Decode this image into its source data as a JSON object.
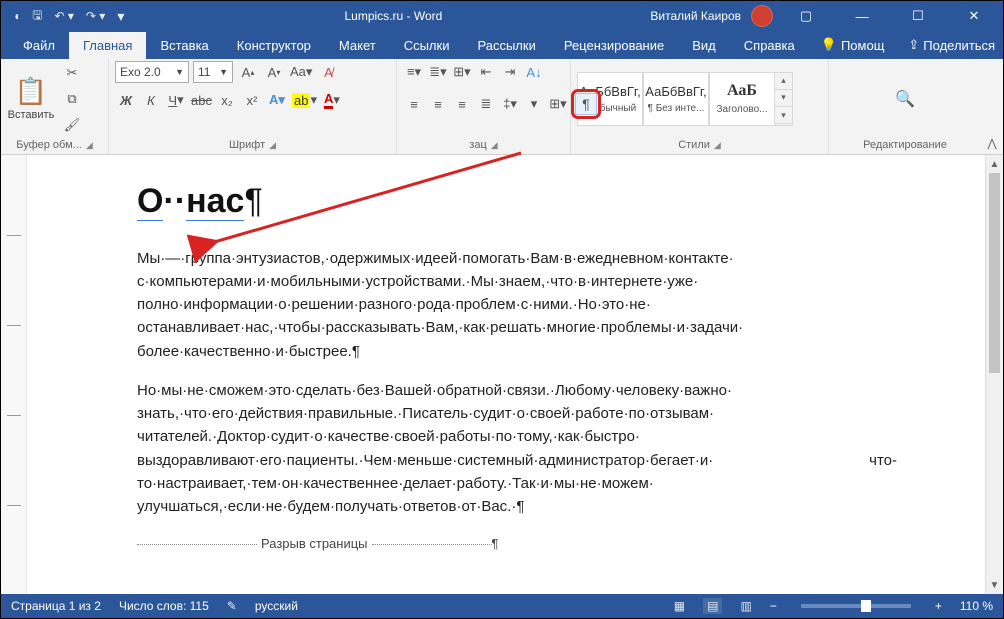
{
  "titlebar": {
    "title": "Lumpics.ru  -  Word",
    "user": "Виталий Каиров"
  },
  "menubar": {
    "file": "Файл",
    "home": "Главная",
    "insert": "Вставка",
    "design": "Конструктор",
    "layout": "Макет",
    "references": "Ссылки",
    "mailings": "Рассылки",
    "review": "Рецензирование",
    "view": "Вид",
    "help": "Справка",
    "tellme": "Помощ",
    "share": "Поделиться"
  },
  "ribbon": {
    "clipboard": {
      "paste": "Вставить",
      "label": "Буфер обм..."
    },
    "font": {
      "name": "Exo 2.0",
      "size": "11",
      "bold": "Ж",
      "italic": "К",
      "underline": "Ч",
      "strike": "abc",
      "sub": "x₂",
      "sup": "x²",
      "label": "Шрифт"
    },
    "paragraph": {
      "pilcrow": "¶",
      "label": "зац"
    },
    "styles": {
      "items": [
        {
          "preview": "АаБбВвГг,",
          "name": "¶ Обычный"
        },
        {
          "preview": "АаБбВвГг,",
          "name": "¶ Без инте..."
        },
        {
          "preview": "АаБ",
          "name": "Заголово..."
        }
      ],
      "label": "Стили"
    },
    "editing": {
      "label": "Редактирование"
    }
  },
  "document": {
    "heading_pre": "О",
    "heading_post": "нас",
    "pil": "¶",
    "p1": "Мы·—·группа·энтузиастов,·одержимых·идеей·помогать·Вам·в·ежедневном·контакте· с·компьютерами·и·мобильными·устройствами.·Мы·знаем,·что·в·интернете·уже· полно·информации·о·решении·разного·рода·проблем·с·ними.·Но·это·не· останавливает·нас,·чтобы·рассказывать·Вам,·как·решать·многие·проблемы·и·задачи· более·качественно·и·быстрее.¶",
    "p2": "Но·мы·не·сможем·это·сделать·без·Вашей·обратной·связи.·Любому·человеку·важно· знать,·что·его·действия·правильные.·Писатель·судит·о·своей·работе·по·отзывам· читателей.·Доктор·судит·о·качестве·своей·работы·по·тому,·как·быстро· выздоравливают·его·пациенты.·Чем·меньше·системный·администратор·бегает·и· что-то·настраивает,·тем·он·качественнее·делает·работу.·Так·и·мы·не·можем· улучшаться,·если·не·будем·получать·ответов·от·Вас.·¶",
    "page_break": "Разрыв страницы"
  },
  "statusbar": {
    "page": "Страница 1 из 2",
    "words": "Число слов: 115",
    "lang": "русский",
    "zoom": "110 %"
  }
}
